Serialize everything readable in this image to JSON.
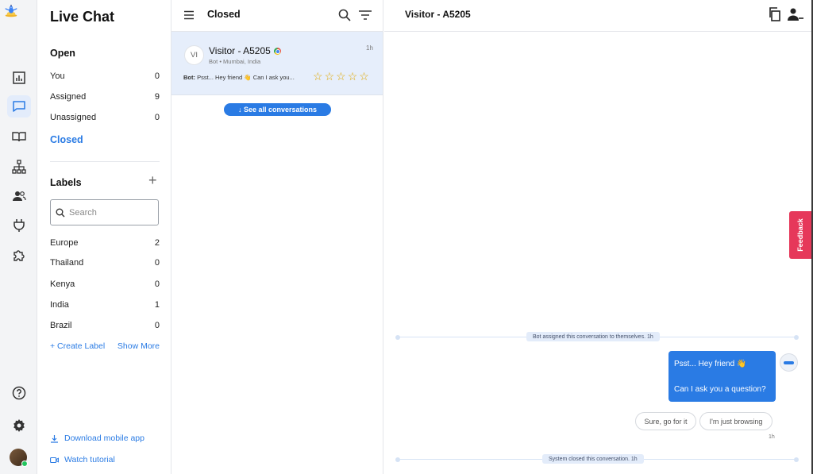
{
  "app": {
    "title": "Live Chat"
  },
  "rail": {
    "icons": [
      "analytics-icon",
      "chat-icon",
      "book-icon",
      "sitemap-icon",
      "contacts-icon",
      "plug-icon",
      "puzzle-icon",
      "help-icon",
      "settings-icon"
    ],
    "active": "chat-icon"
  },
  "sidebar": {
    "open_heading": "Open",
    "open_items": [
      {
        "label": "You",
        "count": "0"
      },
      {
        "label": "Assigned",
        "count": "9"
      },
      {
        "label": "Unassigned",
        "count": "0"
      }
    ],
    "closed_label": "Closed",
    "labels_heading": "Labels",
    "labels_add": "+",
    "search_placeholder": "Search",
    "labels": [
      {
        "label": "Europe",
        "count": "2"
      },
      {
        "label": "Thailand",
        "count": "0"
      },
      {
        "label": "Kenya",
        "count": "0"
      },
      {
        "label": "India",
        "count": "1"
      },
      {
        "label": "Brazil",
        "count": "0"
      }
    ],
    "create_label": "+ Create Label",
    "show_more": "Show More",
    "download_app": "Download mobile app",
    "watch_tutorial": "Watch tutorial"
  },
  "conversations": {
    "header_title": "Closed",
    "items": [
      {
        "initials": "VI",
        "name": "Visitor - A5205",
        "time": "1h",
        "sub": "Bot • Mumbai, India",
        "preview_sender": "Bot:",
        "preview_text": " Psst... Hey friend 👋 Can I ask you...",
        "rating_stars": 5,
        "rating_value": 0
      }
    ],
    "see_all": "↓ See all conversations"
  },
  "chat": {
    "title": "Visitor - A5205",
    "system_messages": [
      "Bot assigned this conversation to themselves. 1h",
      "System closed this conversation. 1h"
    ],
    "bot_message_line1": "Psst... Hey friend 👋",
    "bot_message_line2": "Can I ask you a question?",
    "quick_replies": [
      "Sure, go for it",
      "I'm just browsing"
    ],
    "message_time": "1h",
    "feedback_label": "Feedback"
  },
  "colors": {
    "accent": "#2a7be4",
    "selected_bg": "#e6eefb",
    "feedback": "#e6385a"
  }
}
